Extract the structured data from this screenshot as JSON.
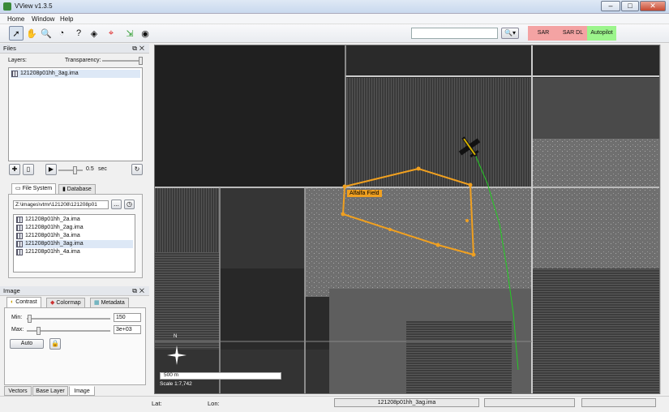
{
  "window": {
    "title": "VView v1.3.5",
    "min": "–",
    "max": "□",
    "close": "✕"
  },
  "menu": [
    "Home",
    "Window",
    "Help"
  ],
  "toolbar": {
    "search_value": "",
    "search_button": "🔍▾",
    "modes": [
      {
        "label": "SAR",
        "color": "#f4a3a3"
      },
      {
        "label": "SAR DL",
        "color": "#f4a3a3"
      },
      {
        "label": "Autopilot",
        "color": "#9cf58c"
      }
    ]
  },
  "files": {
    "header": "Files",
    "layers_label": "Layers:",
    "transparency_label": "Transparency:",
    "layers": [
      "121208p01hh_3ag.ima"
    ],
    "playback_value": "0.5",
    "playback_unit": "sec",
    "tabs": [
      "File System",
      "Database"
    ],
    "path": "Z:\\images\\vtmr\\121208\\121208p01",
    "browse_label": "...",
    "file_list": [
      "121208p01hh_2a.ima",
      "121208p01hh_2ag.ima",
      "121208p01hh_3a.ima",
      "121208p01hh_3ag.ima",
      "121208p01hh_4a.ima"
    ],
    "selected_index": 3
  },
  "image_panel": {
    "header": "Image",
    "tabs": [
      "Contrast",
      "Colormap",
      "Metadata"
    ],
    "min_label": "Min:",
    "min_value": "150",
    "max_label": "Max:",
    "max_value": "3e+03",
    "auto_label": "Auto"
  },
  "bottom_tabs": [
    "Vectors",
    "Base Layer",
    "Image"
  ],
  "map": {
    "polygon_label": "Alfalfa Field",
    "scale_bar": "500 m",
    "scale_text": "Scale 1:7,742",
    "north": "N",
    "polygon_color": "#f0a020",
    "track_color": "#22cc22"
  },
  "status": {
    "lat_label": "Lat:",
    "lon_label": "Lon:",
    "current_file": "121208p01hh_3ag.ima"
  }
}
